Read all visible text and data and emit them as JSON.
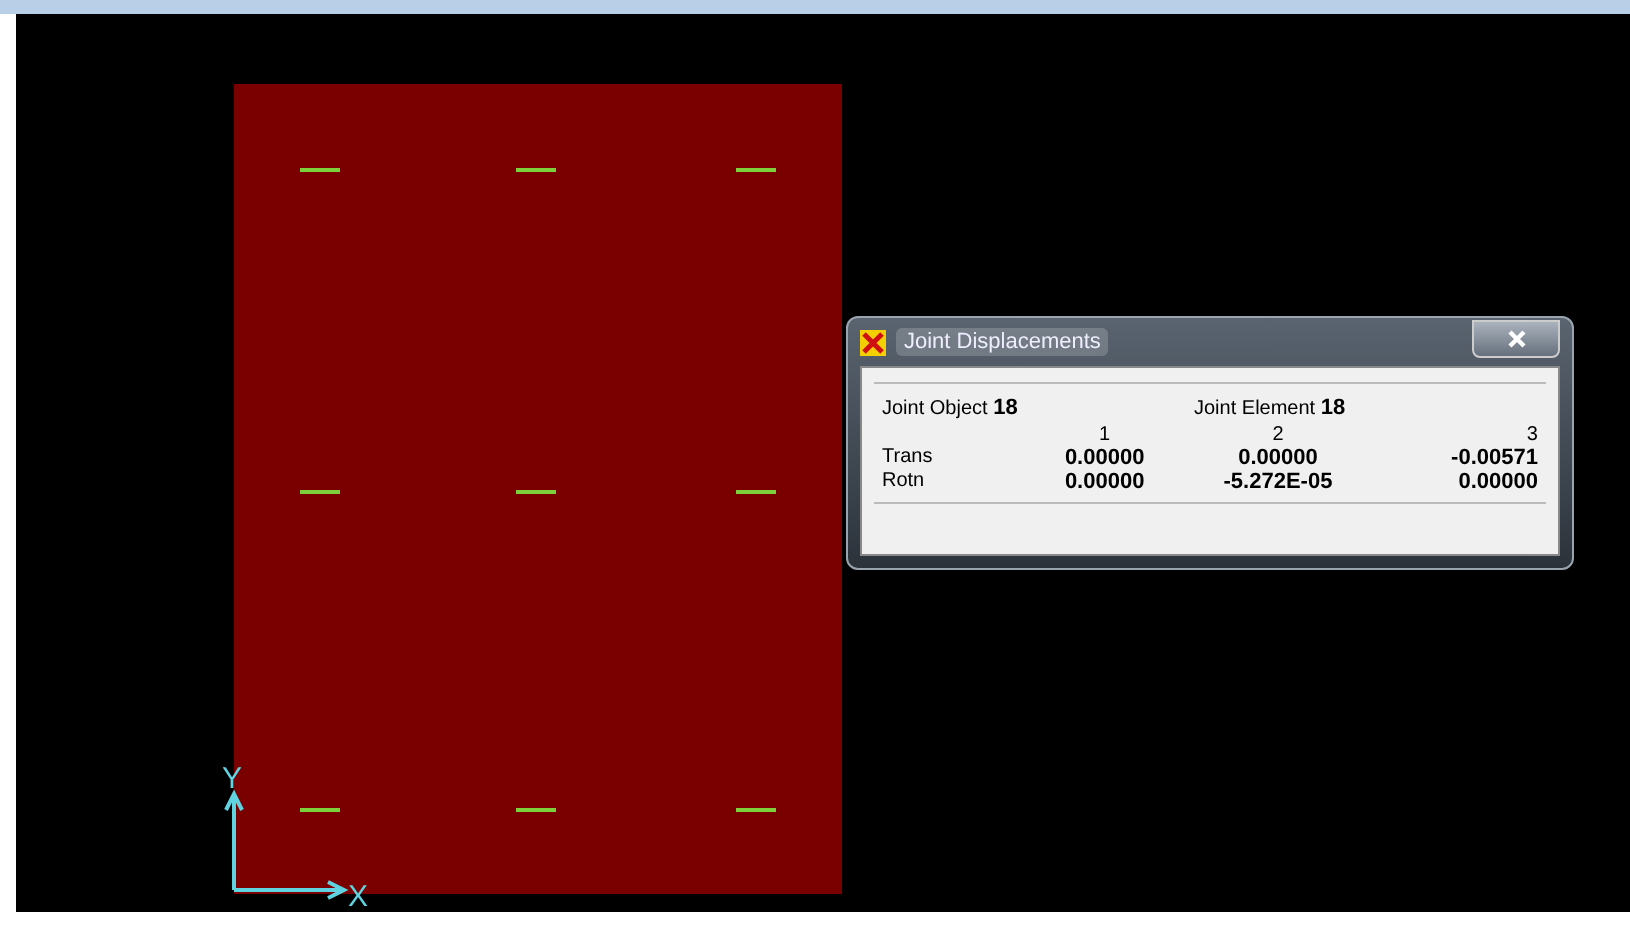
{
  "model_view": {
    "axes": {
      "x_label": "X",
      "y_label": "Y"
    }
  },
  "dialog": {
    "title": "Joint Displacements",
    "joint_object_label": "Joint Object",
    "joint_object": "18",
    "joint_element_label": "Joint Element",
    "joint_element": "18",
    "columns": [
      "1",
      "2",
      "3"
    ],
    "rows": [
      {
        "label": "Trans",
        "values": [
          "0.00000",
          "0.00000",
          "-0.00571"
        ]
      },
      {
        "label": "Rotn",
        "values": [
          "0.00000",
          "-5.272E-05",
          "0.00000"
        ]
      }
    ]
  }
}
